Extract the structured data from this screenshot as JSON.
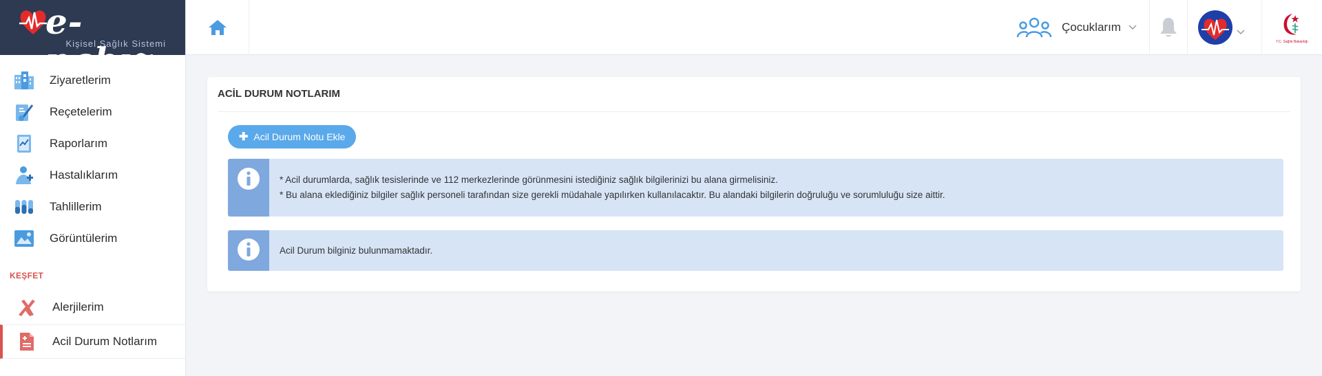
{
  "brand": {
    "name": "e-nabız",
    "tagline": "Kişisel Sağlık Sistemi"
  },
  "sidebar": {
    "items": [
      {
        "label": "Ziyaretlerim",
        "icon": "hospital-building-icon"
      },
      {
        "label": "Reçetelerim",
        "icon": "prescription-icon"
      },
      {
        "label": "Raporlarım",
        "icon": "report-document-icon"
      },
      {
        "label": "Hastalıklarım",
        "icon": "patient-icon"
      },
      {
        "label": "Tahlillerim",
        "icon": "test-tubes-icon"
      },
      {
        "label": "Görüntülerim",
        "icon": "medical-image-icon"
      }
    ],
    "section_title": "KEŞFET",
    "discover_items": [
      {
        "label": "Alerjilerim",
        "icon": "allergy-hand-icon"
      },
      {
        "label": "Acil Durum Notlarım",
        "icon": "emergency-note-icon"
      }
    ]
  },
  "header": {
    "children_label": "Çocuklarım",
    "ministry_text": "T.C. Sağlık Bakanlığı"
  },
  "main": {
    "title": "ACİL DURUM NOTLARIM",
    "add_button": "Acil Durum Notu Ekle",
    "info_line_1": "* Acil durumlarda, sağlık tesislerinde ve 112 merkezlerinde görünmesini istediğiniz sağlık bilgilerinizi bu alana girmelisiniz.",
    "info_line_2": "* Bu alana eklediğiniz bilgiler sağlık personeli tarafından size gerekli müdahale yapılırken kullanılacaktır. Bu alandaki bilgilerin doğruluğu ve sorumluluğu size aittir.",
    "empty_message": "Acil Durum bilginiz bulunmamaktadır."
  },
  "colors": {
    "sidebar_logo_bg": "#2d3a52",
    "accent_blue": "#5aa9ea",
    "alert_bg": "#d6e4f6",
    "alert_side": "#7fa8de",
    "active_red": "#d9534f"
  }
}
